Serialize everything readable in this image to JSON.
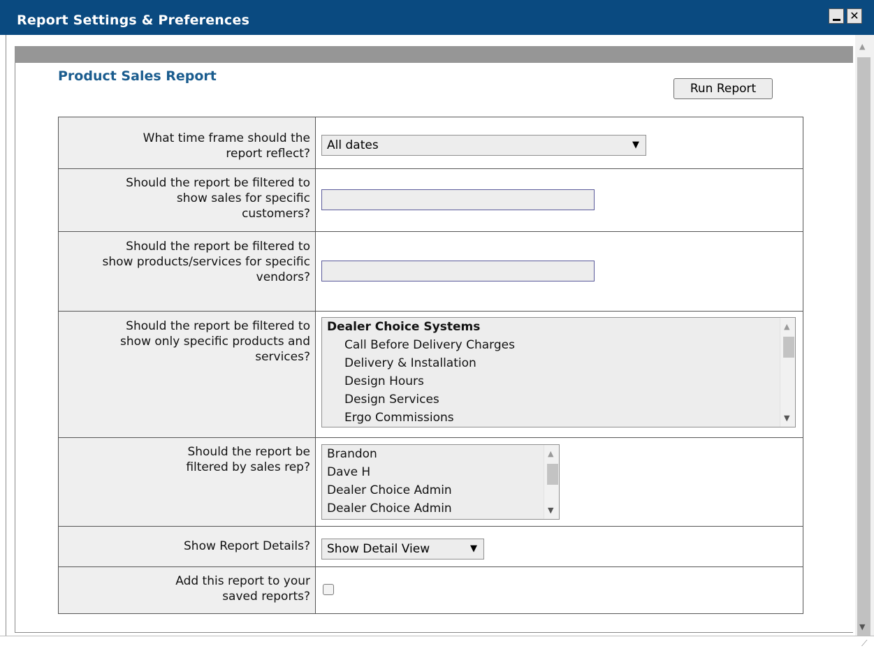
{
  "window": {
    "title": "Report Settings & Preferences",
    "minimize_icon": "minimize-icon",
    "close_icon": "close-icon",
    "close_glyph": "✕"
  },
  "report": {
    "title": "Product Sales Report",
    "run_label": "Run Report"
  },
  "rows": {
    "timeframe": {
      "label": "What time frame should the report reflect?",
      "selected": "All dates"
    },
    "customers": {
      "label": "Should the report be filtered to show sales for specific customers?",
      "value": ""
    },
    "vendors": {
      "label": "Should the report be filtered to show products/services for specific vendors?",
      "value": ""
    },
    "products": {
      "label": "Should the report be filtered to show only specific products and services?",
      "group": "Dealer Choice Systems",
      "items": [
        "Call Before Delivery Charges",
        "Delivery & Installation",
        "Design Hours",
        "Design Services",
        "Ergo Commissions"
      ]
    },
    "salesrep": {
      "label": "Should the report be filtered by sales rep?",
      "items": [
        "Brandon",
        "Dave H",
        "Dealer Choice Admin",
        "Dealer Choice Admin"
      ]
    },
    "details": {
      "label": "Show Report Details?",
      "selected": "Show Detail View"
    },
    "save": {
      "label": "Add this report to your saved reports?",
      "checked": false
    }
  },
  "colors": {
    "titlebar": "#0a4a80",
    "report_title": "#1a5c8e",
    "label_bg": "#efefef",
    "input_bg": "#ededed"
  }
}
